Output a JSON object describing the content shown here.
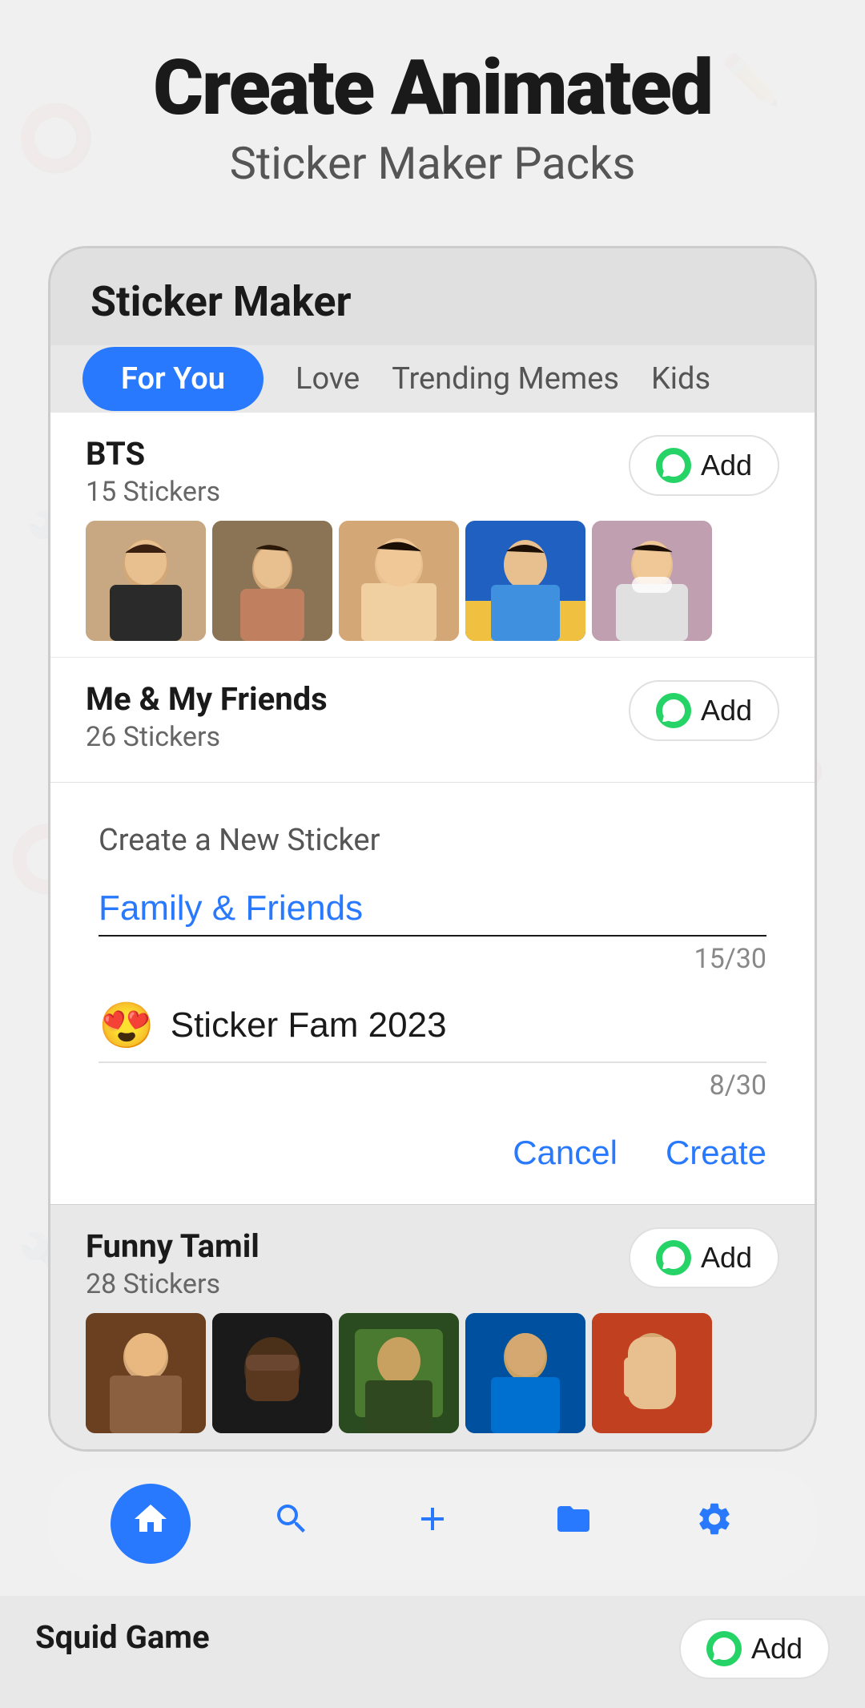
{
  "header": {
    "main_title": "Create Animated",
    "sub_title": "Sticker Maker Packs"
  },
  "phone": {
    "title": "Sticker Maker",
    "tabs": [
      {
        "label": "For You",
        "active": true
      },
      {
        "label": "Love",
        "active": false
      },
      {
        "label": "Trending Memes",
        "active": false
      },
      {
        "label": "Kids",
        "active": false
      }
    ]
  },
  "sticker_packs": [
    {
      "name": "BTS",
      "count": "15 Stickers",
      "add_label": "Add"
    },
    {
      "name": "Me & My Friends",
      "count": "26 Stickers",
      "add_label": "Add"
    }
  ],
  "create_modal": {
    "title": "Create a New Sticker",
    "input1": {
      "value": "Family & Friends",
      "counter": "15/30"
    },
    "input2": {
      "emoji": "😍",
      "value": "Sticker Fam 2023",
      "counter": "8/30"
    },
    "cancel_label": "Cancel",
    "create_label": "Create"
  },
  "bottom_packs": [
    {
      "name": "Funny Tamil",
      "count": "28 Stickers",
      "add_label": "Add"
    },
    {
      "name": "Squid Game",
      "add_label": "Add"
    }
  ],
  "bottom_nav": {
    "home": "🏠",
    "search": "🔍",
    "add": "➕",
    "folder": "📂",
    "settings": "⚙️"
  }
}
